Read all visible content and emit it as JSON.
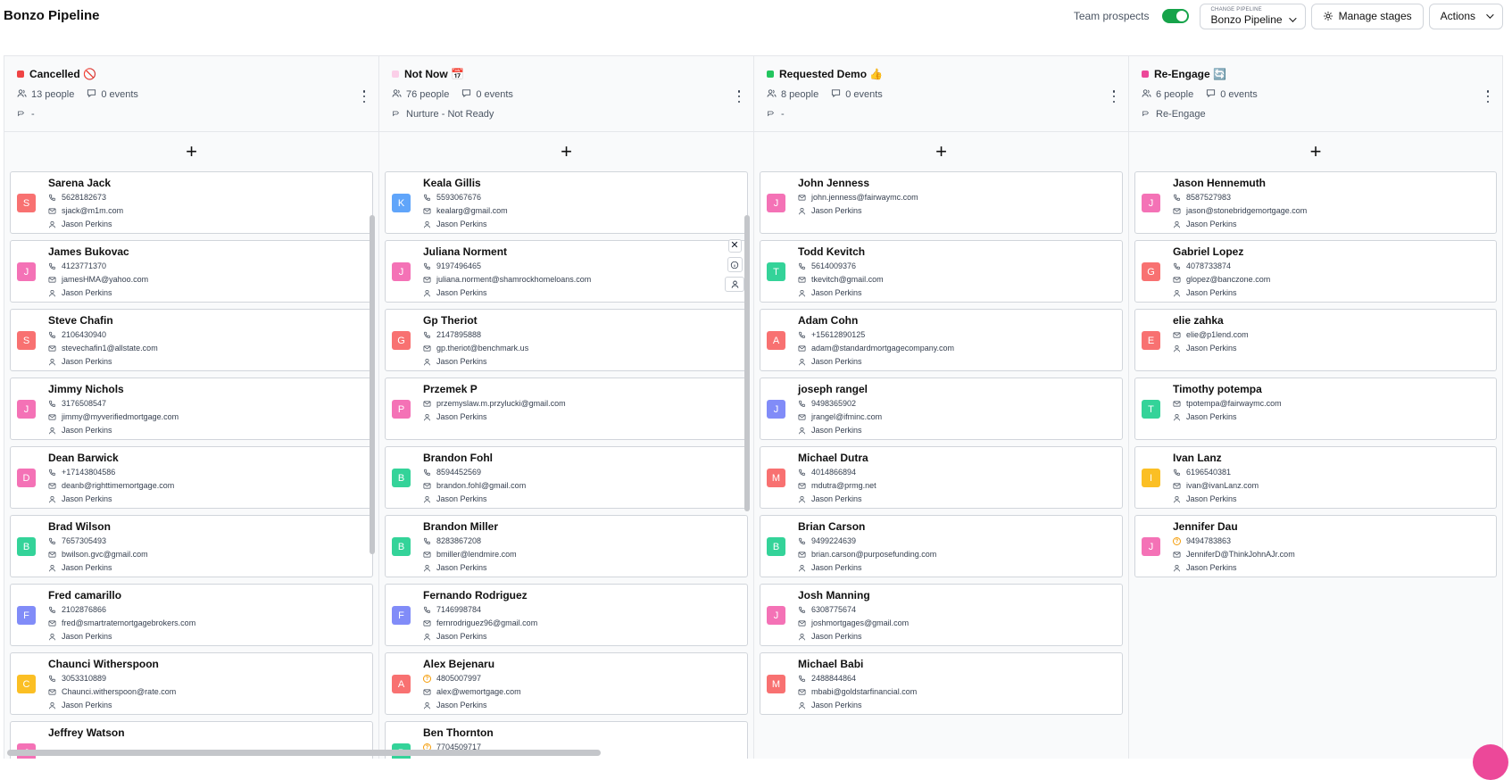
{
  "header": {
    "title": "Bonzo Pipeline",
    "team_prospects_label": "Team prospects",
    "change_pipeline_small": "CHANGE PIPELINE",
    "pipeline_name": "Bonzo Pipeline",
    "manage_stages_label": "Manage stages",
    "actions_label": "Actions"
  },
  "colors": {
    "S": "#f87171",
    "J": "#f472b6",
    "D": "#f472b6",
    "B": "#34d399",
    "F": "#818cf8",
    "C": "#fbbf24",
    "K": "#60a5fa",
    "G": "#f87171",
    "P": "#f472b6",
    "A": "#f87171",
    "T": "#34d399",
    "M": "#f87171",
    "E": "#f87171",
    "I": "#fbbf24"
  },
  "columns": [
    {
      "title": "Cancelled 🚫",
      "dot": "#ef4444",
      "people": "13 people",
      "events": "0 events",
      "tag": "-",
      "cards": [
        {
          "initial": "S",
          "name": "Sarena Jack",
          "phone": "5628182673",
          "email": "sjack@m1m.com",
          "owner": "Jason Perkins"
        },
        {
          "initial": "J",
          "name": "James Bukovac",
          "phone": "4123771370",
          "email": "jamesHMA@yahoo.com",
          "owner": "Jason Perkins"
        },
        {
          "initial": "S",
          "name": "Steve Chafin",
          "phone": "2106430940",
          "email": "stevechafin1@allstate.com",
          "owner": "Jason Perkins"
        },
        {
          "initial": "J",
          "name": "Jimmy Nichols",
          "phone": "3176508547",
          "email": "jimmy@myverifiedmortgage.com",
          "owner": "Jason Perkins"
        },
        {
          "initial": "D",
          "name": "Dean Barwick",
          "phone": "+17143804586",
          "email": "deanb@righttimemortgage.com",
          "owner": "Jason Perkins"
        },
        {
          "initial": "B",
          "name": "Brad Wilson",
          "phone": "7657305493",
          "email": "bwilson.gvc@gmail.com",
          "owner": "Jason Perkins"
        },
        {
          "initial": "F",
          "name": "Fred camarillo",
          "phone": "2102876866",
          "email": "fred@smartratemortgagebrokers.com",
          "owner": "Jason Perkins"
        },
        {
          "initial": "C",
          "name": "Chaunci Witherspoon",
          "phone": "3053310889",
          "email": "Chaunci.witherspoon@rate.com",
          "owner": "Jason Perkins"
        },
        {
          "initial": "J",
          "name": "Jeffrey Watson",
          "phone": "",
          "email": "",
          "owner": ""
        }
      ]
    },
    {
      "title": "Not Now 📅",
      "dot": "#fbcfe8",
      "people": "76 people",
      "events": "0 events",
      "tag": "Nurture - Not Ready",
      "cards": [
        {
          "initial": "K",
          "name": "Keala Gillis",
          "phone": "5593067676",
          "email": "kealarg@gmail.com",
          "owner": "Jason Perkins"
        },
        {
          "initial": "J",
          "name": "Juliana Norment",
          "phone": "9197496465",
          "email": "juliana.norment@shamrockhomeloans.com",
          "owner": "Jason Perkins",
          "hover": true
        },
        {
          "initial": "G",
          "name": "Gp Theriot",
          "phone": "2147895888",
          "email": "gp.theriot@benchmark.us",
          "owner": "Jason Perkins"
        },
        {
          "initial": "P",
          "name": "Przemek P",
          "phone": "",
          "email": "przemyslaw.m.przylucki@gmail.com",
          "owner": "Jason Perkins"
        },
        {
          "initial": "B",
          "name": "Brandon Fohl",
          "phone": "8594452569",
          "email": "brandon.fohl@gmail.com",
          "owner": "Jason Perkins"
        },
        {
          "initial": "B",
          "name": "Brandon Miller",
          "phone": "8283867208",
          "email": "bmiller@lendmire.com",
          "owner": "Jason Perkins"
        },
        {
          "initial": "F",
          "name": "Fernando Rodriguez",
          "phone": "7146998784",
          "email": "fernrodriguez96@gmail.com",
          "owner": "Jason Perkins"
        },
        {
          "initial": "A",
          "name": "Alex Bejenaru",
          "phone": "4805007997",
          "phone_warn": true,
          "email": "alex@wemortgage.com",
          "owner": "Jason Perkins"
        },
        {
          "initial": "B",
          "name": "Ben Thornton",
          "phone": "7704509717",
          "phone_warn": true,
          "email": "",
          "owner": ""
        }
      ]
    },
    {
      "title": "Requested Demo 👍",
      "dot": "#22c55e",
      "people": "8 people",
      "events": "0 events",
      "tag": "-",
      "cards": [
        {
          "initial": "J",
          "name": "John Jenness",
          "phone": "",
          "email": "john.jenness@fairwaymc.com",
          "owner": "Jason Perkins"
        },
        {
          "initial": "T",
          "name": "Todd Kevitch",
          "phone": "5614009376",
          "email": "tkevitch@gmail.com",
          "owner": "Jason Perkins"
        },
        {
          "initial": "A",
          "name": "Adam Cohn",
          "phone": "+15612890125",
          "email": "adam@standardmortgagecompany.com",
          "owner": "Jason Perkins"
        },
        {
          "initial": "J",
          "name": "joseph rangel",
          "phone": "9498365902",
          "email": "jrangel@ifminc.com",
          "owner": "Jason Perkins",
          "avatar": "#818cf8"
        },
        {
          "initial": "M",
          "name": "Michael Dutra",
          "phone": "4014866894",
          "email": "mdutra@prmg.net",
          "owner": "Jason Perkins"
        },
        {
          "initial": "B",
          "name": "Brian Carson",
          "phone": "9499224639",
          "email": "brian.carson@purposefunding.com",
          "owner": "Jason Perkins"
        },
        {
          "initial": "J",
          "name": "Josh Manning",
          "phone": "6308775674",
          "email": "joshmortgages@gmail.com",
          "owner": "Jason Perkins"
        },
        {
          "initial": "M",
          "name": "Michael Babi",
          "phone": "2488844864",
          "email": "mbabi@goldstarfinancial.com",
          "owner": "Jason Perkins"
        }
      ]
    },
    {
      "title": "Re-Engage 🔄",
      "dot": "#ec4899",
      "people": "6 people",
      "events": "0 events",
      "tag": "Re-Engage",
      "cards": [
        {
          "initial": "J",
          "name": "Jason Hennemuth",
          "phone": "8587527983",
          "email": "jason@stonebridgemortgage.com",
          "owner": "Jason Perkins"
        },
        {
          "initial": "G",
          "name": "Gabriel Lopez",
          "phone": "4078733874",
          "email": "glopez@banczone.com",
          "owner": "Jason Perkins"
        },
        {
          "initial": "E",
          "name": "elie zahka",
          "phone": "",
          "email": "elie@p1lend.com",
          "owner": "Jason Perkins"
        },
        {
          "initial": "T",
          "name": "Timothy potempa",
          "phone": "",
          "email": "tpotempa@fairwaymc.com",
          "owner": "Jason Perkins"
        },
        {
          "initial": "I",
          "name": "Ivan Lanz",
          "phone": "6196540381",
          "email": "ivan@ivanLanz.com",
          "owner": "Jason Perkins"
        },
        {
          "initial": "J",
          "name": "Jennifer Dau",
          "phone": "9494783863",
          "phone_warn": true,
          "email": "JenniferD@ThinkJohnAJr.com",
          "owner": "Jason Perkins"
        }
      ]
    }
  ]
}
